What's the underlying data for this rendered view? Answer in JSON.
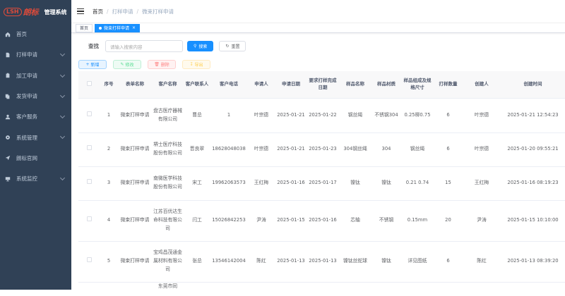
{
  "logo": {
    "mark": "LSH",
    "brand": "朗标",
    "title": "管理系统"
  },
  "sidebar": {
    "items": [
      {
        "label": "首页",
        "icon": "home-icon",
        "expandable": false
      },
      {
        "label": "打样申请",
        "icon": "document-icon",
        "expandable": true
      },
      {
        "label": "加工申请",
        "icon": "clipboard-icon",
        "expandable": true
      },
      {
        "label": "发货申请",
        "icon": "copy-icon",
        "expandable": true
      },
      {
        "label": "客户服务",
        "icon": "user-group-icon",
        "expandable": true
      },
      {
        "label": "系统管理",
        "icon": "gear-icon",
        "expandable": true
      },
      {
        "label": "朗标官网",
        "icon": "send-icon",
        "expandable": false
      },
      {
        "label": "系统监控",
        "icon": "monitor-icon",
        "expandable": true
      }
    ]
  },
  "breadcrumb": {
    "items": [
      "首页",
      "打样申请",
      "微束打样申请"
    ]
  },
  "tags": {
    "items": [
      {
        "label": "首页",
        "active": false
      },
      {
        "label": "微束打样申请",
        "active": true
      }
    ]
  },
  "search": {
    "label": "查找",
    "placeholder": "请输入搜索内容",
    "search_label": "搜索",
    "reset_label": "重置"
  },
  "toolbar": {
    "add_label": "新增",
    "edit_label": "修改",
    "delete_label": "删除",
    "export_label": "导出"
  },
  "table": {
    "headers": [
      "",
      "序号",
      "表单名称",
      "客户名称",
      "客户联系人",
      "客户电话",
      "申请人",
      "申请日期",
      "要求打样完成日期",
      "样品名称",
      "样品材质",
      "样品组成及规格尺寸",
      "打样数量",
      "创建人",
      "创建时间"
    ],
    "rows": [
      [
        "",
        "1",
        "微束打样申请",
        "盘古医疗器械有限公司",
        "曹总",
        "1",
        "叶宗德",
        "2025-01-21",
        "2025-01-22",
        "钢丝绳",
        "不锈钢304",
        "0.25柳0.75",
        "6",
        "叶宗德",
        "2025-01-21 12:54:23"
      ],
      [
        "",
        "2",
        "微束打样申请",
        "堺士医疗科技股份有限公司",
        "晋良翠",
        "18628048038",
        "叶宗德",
        "2025-01-21",
        "2025-01-23",
        "304钢丝绳",
        "304",
        "钢丝绳",
        "6",
        "叶宗德",
        "2025-01-20 09:55:21"
      ],
      [
        "",
        "3",
        "微束打样申请",
        "南微医学科技股份有限公司",
        "宋工",
        "19962063573",
        "王红梅",
        "2025-01-16",
        "2025-01-17",
        "镍钛",
        "镍钛",
        "0.21 0.74",
        "15",
        "王红梅",
        "2025-01-16 08:19:23"
      ],
      [
        "",
        "4",
        "微束打样申请",
        "江苏百优达生命科技有限公司",
        "闫工",
        "15026842253",
        "尹涛",
        "2025-01-15",
        "2025-01-16",
        "芯轴",
        "不锈钢",
        "0.15mm",
        "20",
        "尹涛",
        "2025-01-15 10:10:00"
      ],
      [
        "",
        "5",
        "微束打样申请",
        "宝鸡昌茂通金属材料有限公司",
        "张总",
        "13546142004",
        "陈红",
        "2025-01-13",
        "2025-01-13",
        "镍钛丝蛇球",
        "镍钛",
        "详见图纸",
        "6",
        "陈红",
        "2025-01-13 08:39:20"
      ],
      [
        "",
        "",
        "",
        "东莞市同",
        "",
        "",
        "",
        "",
        "",
        "",
        "",
        "",
        "",
        "",
        ""
      ]
    ]
  }
}
